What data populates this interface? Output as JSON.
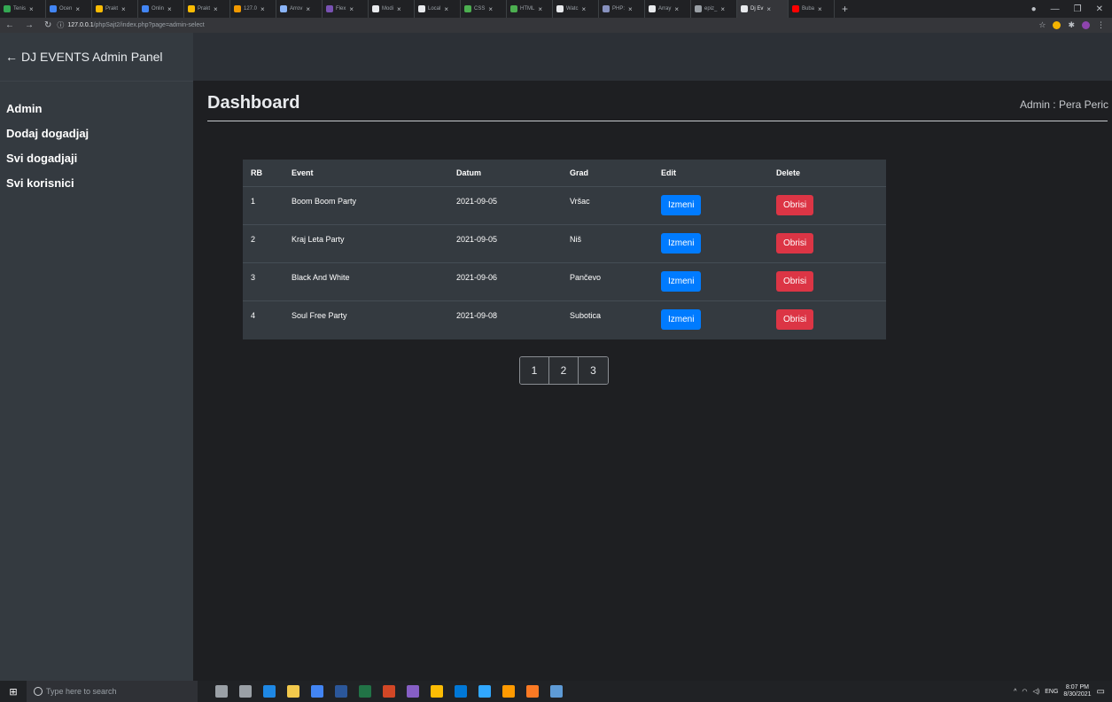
{
  "browser": {
    "tabs": [
      {
        "label": "Tenis",
        "color": "#34a853"
      },
      {
        "label": "Ocen",
        "color": "#4285f4"
      },
      {
        "label": "Prakt",
        "color": "#fbbc04"
      },
      {
        "label": "Onlin",
        "color": "#4285f4"
      },
      {
        "label": "Prakt",
        "color": "#fbbc04"
      },
      {
        "label": "127.0",
        "color": "#f29900"
      },
      {
        "label": "Arrov",
        "color": "#8ab4f8"
      },
      {
        "label": "Flex",
        "color": "#7952b3"
      },
      {
        "label": "Modi",
        "color": "#e8eaed"
      },
      {
        "label": "Local",
        "color": "#e8eaed"
      },
      {
        "label": "CSS",
        "color": "#4caf50"
      },
      {
        "label": "HTML",
        "color": "#4caf50"
      },
      {
        "label": "Watc",
        "color": "#e8eaed"
      },
      {
        "label": "PHP:",
        "color": "#8892bf"
      },
      {
        "label": "Array",
        "color": "#e8eaed"
      },
      {
        "label": "epiz_",
        "color": "#9aa0a6"
      },
      {
        "label": "Dj Ev",
        "color": "#e8eaed",
        "active": true
      },
      {
        "label": "Buba",
        "color": "#ff0000"
      }
    ],
    "new_tab": "+",
    "close_glyph": "×",
    "url_host": "127.0.0.1",
    "url_path": "/phpSajt2/index.php?page=admin-select"
  },
  "sidebar": {
    "brand": "DJ EVENTS Admin Panel",
    "items": [
      {
        "label": "Admin"
      },
      {
        "label": "Dodaj dogadjaj"
      },
      {
        "label": "Svi dogadjaji"
      },
      {
        "label": "Svi korisnici"
      }
    ]
  },
  "main": {
    "title": "Dashboard",
    "admin_user": "Admin : Pera Peric"
  },
  "table": {
    "headers": {
      "rb": "RB",
      "event": "Event",
      "datum": "Datum",
      "grad": "Grad",
      "edit": "Edit",
      "delete": "Delete"
    },
    "rows": [
      {
        "rb": "1",
        "event": "Boom Boom Party",
        "datum": "2021-09-05",
        "grad": "Vršac",
        "edit": "Izmeni",
        "delete": "Obrisi"
      },
      {
        "rb": "2",
        "event": "Kraj Leta Party",
        "datum": "2021-09-05",
        "grad": "Niš",
        "edit": "Izmeni",
        "delete": "Obrisi"
      },
      {
        "rb": "3",
        "event": "Black And White",
        "datum": "2021-09-06",
        "grad": "Pančevo",
        "edit": "Izmeni",
        "delete": "Obrisi"
      },
      {
        "rb": "4",
        "event": "Soul Free Party",
        "datum": "2021-09-08",
        "grad": "Subotica",
        "edit": "Izmeni",
        "delete": "Obrisi"
      }
    ]
  },
  "pagination": {
    "pages": [
      "1",
      "2",
      "3"
    ]
  },
  "taskbar": {
    "search_placeholder": "Type here to search",
    "tray_lang": "ENG",
    "time": "8:07 PM",
    "date": "8/30/2021",
    "icons": [
      {
        "name": "mic-icon",
        "color": "#9aa0a6"
      },
      {
        "name": "task-view-icon",
        "color": "#9aa0a6"
      },
      {
        "name": "edge-icon",
        "color": "#1e88e5"
      },
      {
        "name": "file-explorer-icon",
        "color": "#f2c94c"
      },
      {
        "name": "store-icon",
        "color": "#4285f4"
      },
      {
        "name": "word-icon",
        "color": "#2b579a"
      },
      {
        "name": "excel-icon",
        "color": "#217346"
      },
      {
        "name": "powerpoint-icon",
        "color": "#d24726"
      },
      {
        "name": "visual-studio-icon",
        "color": "#865fc5"
      },
      {
        "name": "chrome-icon",
        "color": "#fbbc04"
      },
      {
        "name": "vscode-icon",
        "color": "#0078d7"
      },
      {
        "name": "photoshop-icon",
        "color": "#31a8ff"
      },
      {
        "name": "illustrator-icon",
        "color": "#ff9a00"
      },
      {
        "name": "xampp-icon",
        "color": "#fb7a24"
      },
      {
        "name": "app-icon",
        "color": "#5e9bd6"
      }
    ]
  },
  "colors": {
    "sidebar_bg": "#343a40",
    "edit_button": "#007bff",
    "delete_button": "#dc3545"
  }
}
